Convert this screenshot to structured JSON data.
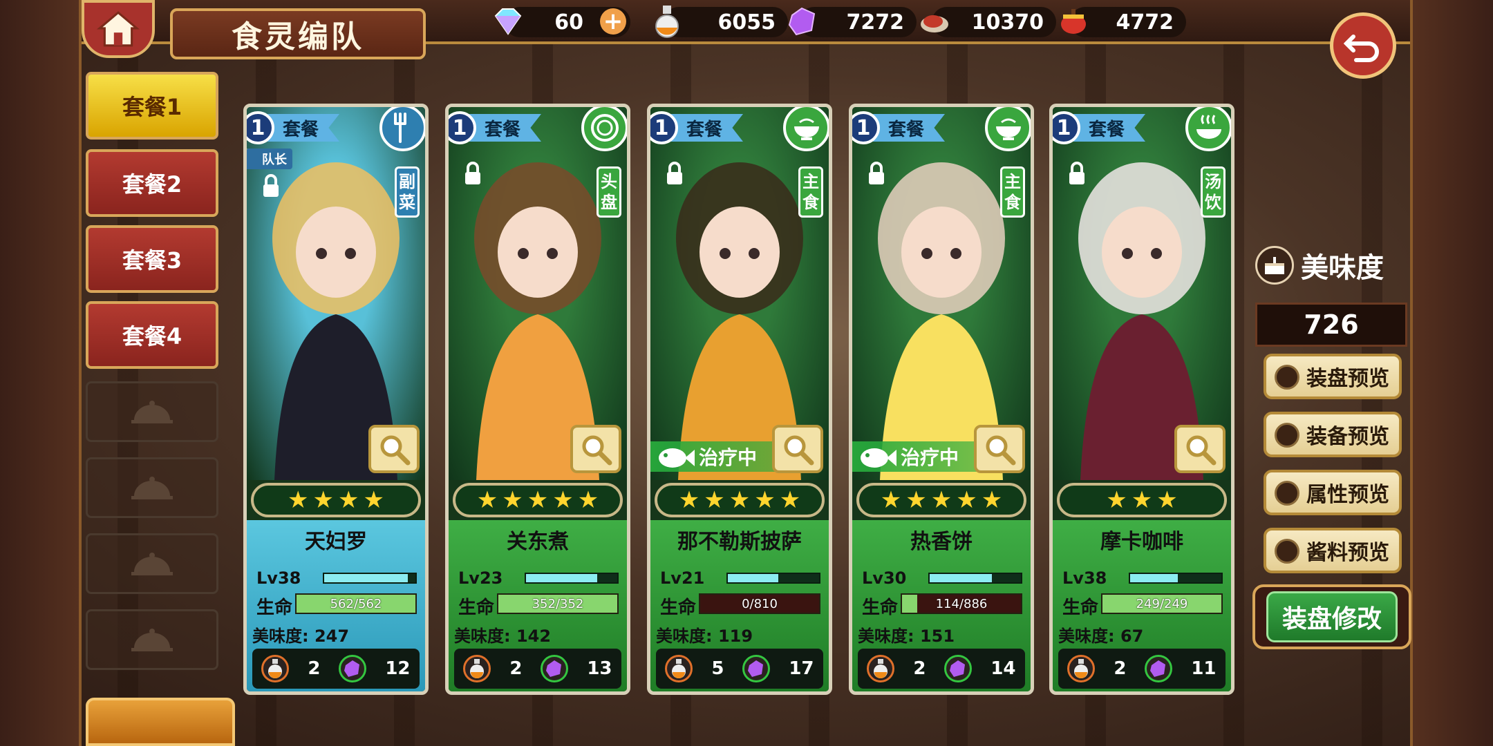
{
  "header": {
    "title": "食灵编队"
  },
  "resources": [
    {
      "name": "diamond",
      "icon": "diamond-icon",
      "value": "60"
    },
    {
      "name": "oil",
      "icon": "oil-flask-icon",
      "value": "6055"
    },
    {
      "name": "crystal",
      "icon": "purple-crystal-icon",
      "value": "7272"
    },
    {
      "name": "meat",
      "icon": "meat-icon",
      "value": "10370"
    },
    {
      "name": "pot",
      "icon": "pot-icon",
      "value": "4772"
    }
  ],
  "tabs": [
    "套餐1",
    "套餐2",
    "套餐3",
    "套餐4"
  ],
  "cards": [
    {
      "set_num": "1",
      "set_label": "套餐",
      "dish_type": "副菜",
      "type_icon": "fork-icon",
      "type_color": "#2e7fb0",
      "leader": "队长",
      "stars": 4,
      "healing": "",
      "name": "天妇罗",
      "level": "Lv38",
      "xp": 0.92,
      "hp_label": "生命",
      "hp_text": "562/562",
      "hp": 1.0,
      "taste": "美味度: 247",
      "oil_cost": "2",
      "crystal_cost": "12",
      "theme": "blue"
    },
    {
      "set_num": "1",
      "set_label": "套餐",
      "dish_type": "头盘",
      "type_icon": "plate-icon",
      "type_color": "#3aa63e",
      "leader": "",
      "stars": 5,
      "healing": "",
      "name": "关东煮",
      "level": "Lv23",
      "xp": 0.78,
      "hp_label": "生命",
      "hp_text": "352/352",
      "hp": 1.0,
      "taste": "美味度: 142",
      "oil_cost": "2",
      "crystal_cost": "13",
      "theme": "green"
    },
    {
      "set_num": "1",
      "set_label": "套餐",
      "dish_type": "主食",
      "type_icon": "bowl-icon",
      "type_color": "#3aa63e",
      "leader": "",
      "stars": 5,
      "healing": "治疗中",
      "name": "那不勒斯披萨",
      "level": "Lv21",
      "xp": 0.55,
      "hp_label": "生命",
      "hp_text": "0/810",
      "hp": 0.0,
      "taste": "美味度: 119",
      "oil_cost": "5",
      "crystal_cost": "17",
      "theme": "green"
    },
    {
      "set_num": "1",
      "set_label": "套餐",
      "dish_type": "主食",
      "type_icon": "bowl-icon",
      "type_color": "#3aa63e",
      "leader": "",
      "stars": 5,
      "healing": "治疗中",
      "name": "热香饼",
      "level": "Lv30",
      "xp": 0.68,
      "hp_label": "生命",
      "hp_text": "114/886",
      "hp": 0.13,
      "taste": "美味度: 151",
      "oil_cost": "2",
      "crystal_cost": "14",
      "theme": "green"
    },
    {
      "set_num": "1",
      "set_label": "套餐",
      "dish_type": "汤饮",
      "type_icon": "soup-icon",
      "type_color": "#3aa63e",
      "leader": "",
      "stars": 3,
      "healing": "",
      "name": "摩卡咖啡",
      "level": "Lv38",
      "xp": 0.52,
      "hp_label": "生命",
      "hp_text": "249/249",
      "hp": 1.0,
      "taste": "美味度: 67",
      "oil_cost": "2",
      "crystal_cost": "11",
      "theme": "green"
    }
  ],
  "side": {
    "taste_title": "美味度",
    "taste_value": "726",
    "previews": [
      "装盘预览",
      "装备预览",
      "属性预览",
      "酱料预览"
    ],
    "edit_label": "装盘修改"
  }
}
